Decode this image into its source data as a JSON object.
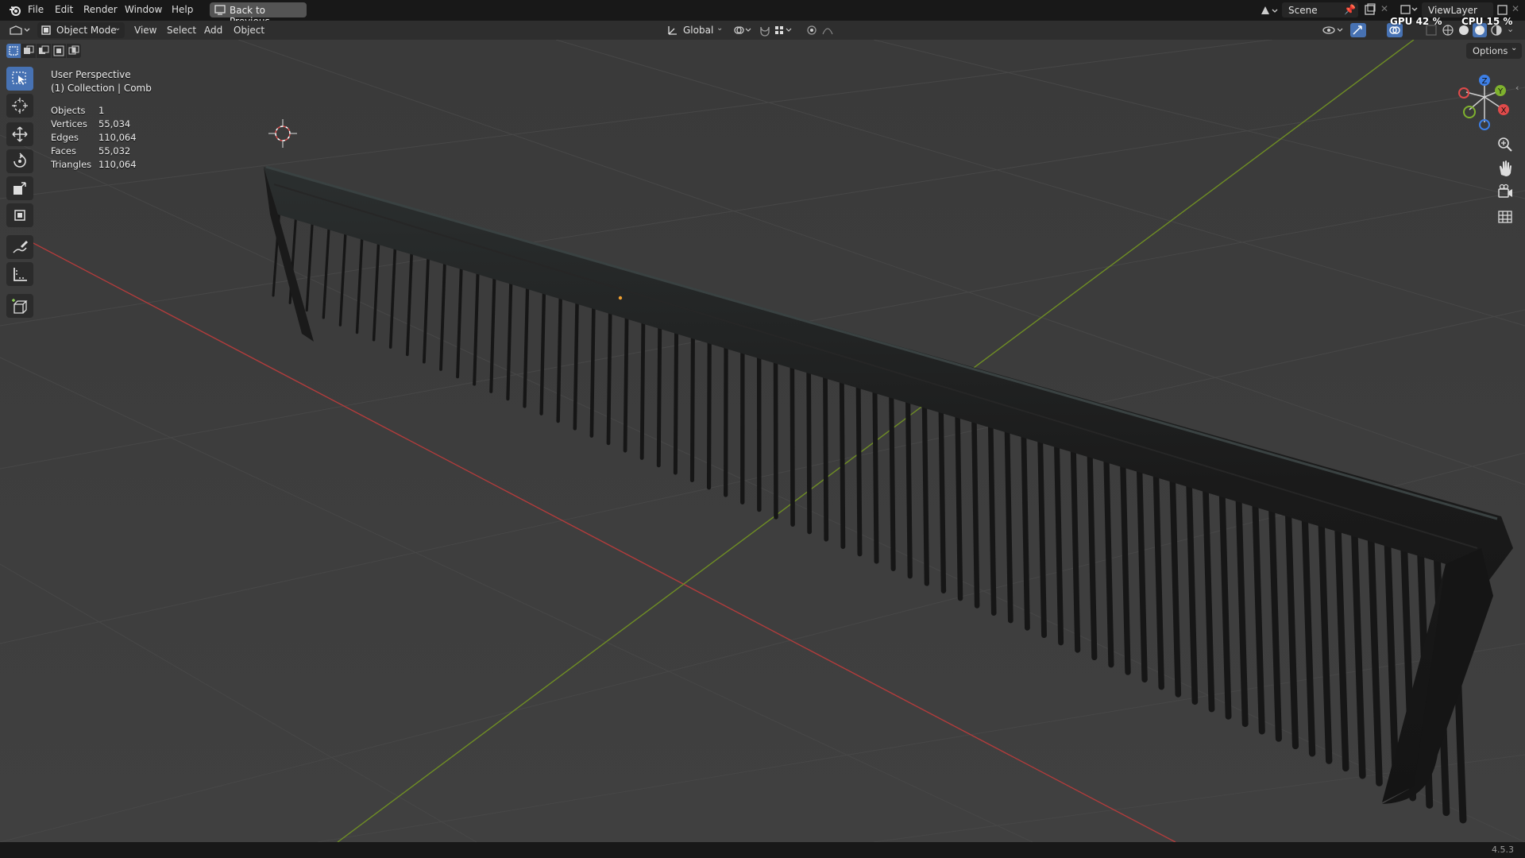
{
  "menu": {
    "items": [
      "File",
      "Edit",
      "Render",
      "Window",
      "Help"
    ],
    "back_button": "Back to Previous"
  },
  "scene": {
    "label": "Scene"
  },
  "view_layer": {
    "label": "ViewLayer"
  },
  "perf": {
    "gpu": "GPU 42 %",
    "cpu": "CPU 15 %"
  },
  "header": {
    "mode": "Object Mode",
    "menus": [
      "View",
      "Select",
      "Add",
      "Object"
    ],
    "orientation": "Global",
    "options": "Options"
  },
  "viewport": {
    "perspective": "User Perspective",
    "collection": "(1) Collection | Comb",
    "stats": [
      {
        "label": "Objects",
        "value": "1"
      },
      {
        "label": "Vertices",
        "value": "55,034"
      },
      {
        "label": "Edges",
        "value": "110,064"
      },
      {
        "label": "Faces",
        "value": "55,032"
      },
      {
        "label": "Triangles",
        "value": "110,064"
      }
    ]
  },
  "gizmo": {
    "axes": [
      "Z",
      "Y",
      "X"
    ]
  },
  "status": {
    "version": "4.5.3"
  },
  "colors": {
    "x_axis": "#c84545",
    "y_axis": "#7c9c2c",
    "accent": "#4772b3",
    "comb": "#1c1c1c"
  },
  "icons": [
    "blender-logo-icon",
    "back-icon",
    "scene-icon",
    "pin-icon",
    "new-scene-icon",
    "viewlayer-icon",
    "select-box-icon",
    "cursor-icon",
    "move-icon",
    "rotate-icon",
    "scale-icon",
    "transform-icon",
    "annotate-icon",
    "measure-icon",
    "add-cube-icon",
    "zoom-icon",
    "pan-hand-icon",
    "camera-icon",
    "grid-icon"
  ]
}
